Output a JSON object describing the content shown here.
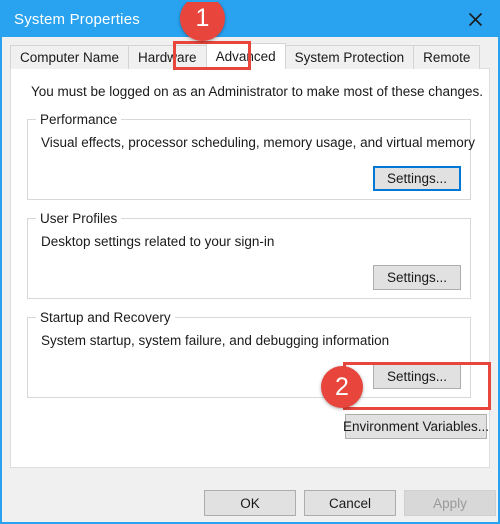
{
  "window": {
    "title": "System Properties",
    "close_icon": "close-icon"
  },
  "tabs": [
    {
      "label": "Computer Name",
      "selected": false
    },
    {
      "label": "Hardware",
      "selected": false
    },
    {
      "label": "Advanced",
      "selected": true
    },
    {
      "label": "System Protection",
      "selected": false
    },
    {
      "label": "Remote",
      "selected": false
    }
  ],
  "content": {
    "intro": "You must be logged on as an Administrator to make most of these changes.",
    "groups": [
      {
        "label": "Performance",
        "description": "Visual effects, processor scheduling, memory usage, and virtual memory",
        "button": "Settings..."
      },
      {
        "label": "User Profiles",
        "description": "Desktop settings related to your sign-in",
        "button": "Settings..."
      },
      {
        "label": "Startup and Recovery",
        "description": "System startup, system failure, and debugging information",
        "button": "Settings..."
      }
    ],
    "environment_variables_button": "Environment Variables..."
  },
  "footer": {
    "ok": "OK",
    "cancel": "Cancel",
    "apply": "Apply"
  },
  "annotations": [
    {
      "number": "1",
      "target": "Advanced tab"
    },
    {
      "number": "2",
      "target": "Startup and Recovery Settings button"
    }
  ],
  "colors": {
    "titlebar": "#29a3f0",
    "annotation": "#e8453c",
    "focus": "#0078d7"
  }
}
